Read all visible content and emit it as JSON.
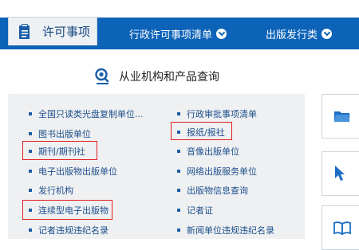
{
  "tabs": {
    "active_label": "许可事项",
    "admin_list_label": "行政许可事项清单",
    "publishing_label": "出版发行类"
  },
  "heading": {
    "label": "从业机构和产品查询"
  },
  "left_items": [
    "全国只读类光盘复制单位...",
    "图书出版单位",
    "期刊/期刊社",
    "电子出版物出版单位",
    "发行机构",
    "连续型电子出版物",
    "记者违规违纪名录"
  ],
  "right_items": [
    "行政审批事项清单",
    "报纸/报社",
    "音像出版单位",
    "网络出版服务单位",
    "出版物信息查询",
    "记者证",
    "新闻单位违规违纪名录"
  ],
  "right_cards": [
    {
      "icon": "folder-icon",
      "letter": "",
      "icon_color": "#1d6fc4"
    },
    {
      "icon": "cursor-icon",
      "letter": "",
      "icon_color": "#1d6fc4"
    },
    {
      "icon": "book-icon",
      "letter": "",
      "icon_color": "#1d6fc4"
    }
  ],
  "colors": {
    "nav_blue": "#0d63b8",
    "link_blue": "#1e4f8c",
    "highlight_red": "#e32020",
    "panel_bg": "#eef0f2"
  }
}
